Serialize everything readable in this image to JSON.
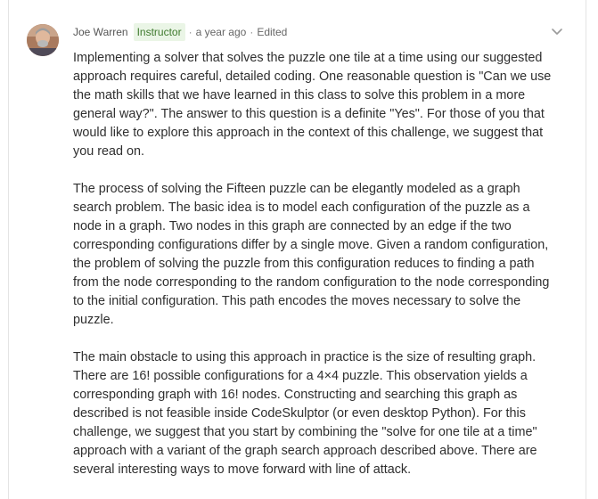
{
  "comment": {
    "author": "Joe Warren",
    "role_badge": "Instructor",
    "separator": "·",
    "timestamp": "a year ago",
    "edited_label": "Edited",
    "avatar_icon": "user-avatar-icon",
    "menu_icon": "chevron-down-icon",
    "paragraphs": [
      "Implementing a solver that solves the puzzle one tile at a time using our suggested approach requires careful, detailed coding. One reasonable question is \"Can we use the math skills that we have learned in this class to solve this problem in a more general way?\". The answer to this question is a definite \"Yes\". For those of you that would like to explore this approach in the context of this challenge, we suggest that you read on.",
      "The process of solving the Fifteen puzzle can be elegantly modeled as a graph search problem. The basic idea is to model each configuration of the puzzle as a node in a graph. Two nodes in this graph are connected by an edge if the two corresponding configurations differ by a single move. Given a random configuration, the problem of solving the puzzle from this configuration reduces to finding a path from the node corresponding to the random configuration to the node corresponding to the initial configuration. This path encodes the moves necessary to solve the puzzle.",
      "The main obstacle to using this approach in practice is the size of resulting graph. There are 16! possible configurations for a 4×4 puzzle. This observation yields a corresponding graph with 16! nodes. Constructing and searching this graph as described is not feasible inside CodeSkulptor (or even desktop Python). For this challenge, we suggest that you start by combining the \"solve for one tile at a time\" approach with a variant of the graph search approach described above. There are several interesting ways to move forward with line of attack."
    ]
  },
  "colors": {
    "badge_bg": "#eaf5e6",
    "badge_text": "#3f7a2e",
    "body_text": "#2f2f2f",
    "meta_text": "#666666",
    "border": "#e4e4e4"
  }
}
